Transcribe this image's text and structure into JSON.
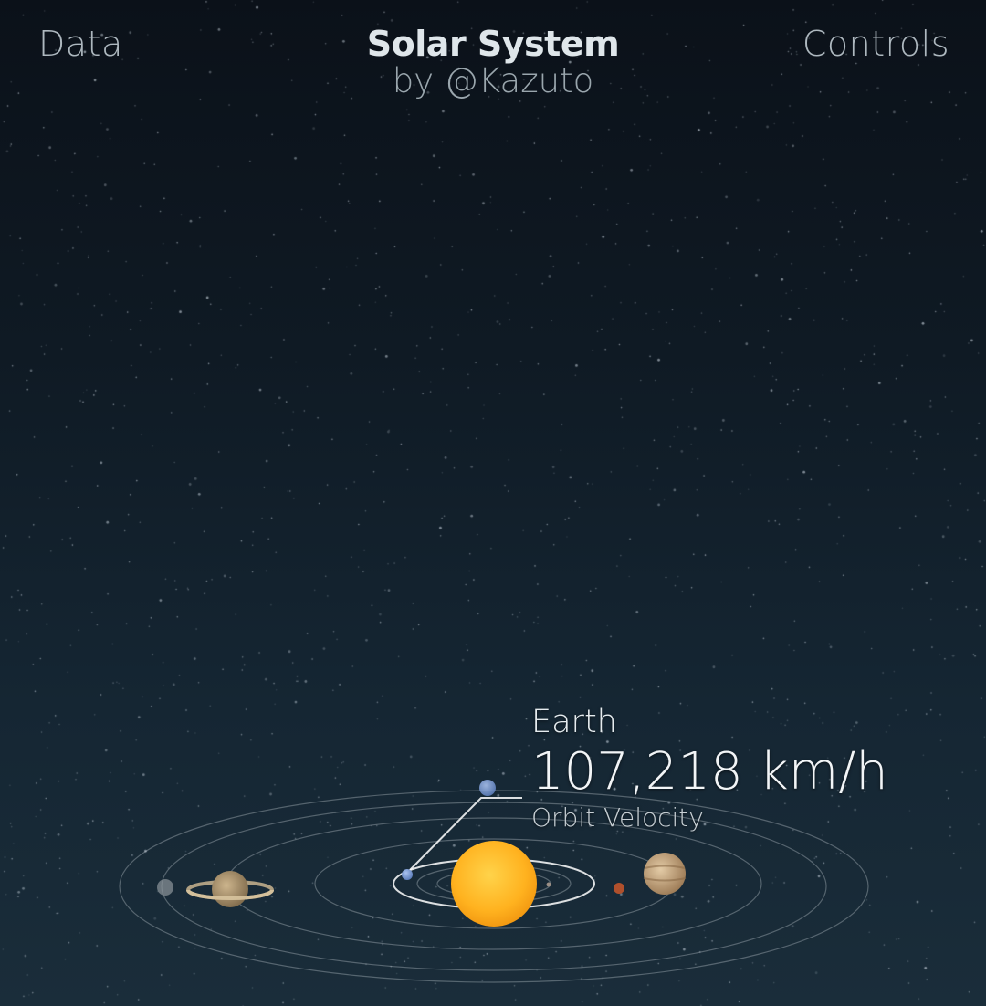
{
  "header": {
    "left_link": "Data",
    "title": "Solar System",
    "subtitle": "by @Kazuto",
    "right_link": "Controls"
  },
  "selected_planet": {
    "name": "Earth",
    "value": "107,218 km/h",
    "label": "Orbit Velocity"
  },
  "colors": {
    "sun": "#ffb21f",
    "earth": "#7d9fd6",
    "mars": "#b0502c",
    "jupiter": "#c9a47a",
    "saturn": "#b9a07a",
    "orbit": "#c9d2d8"
  },
  "bodies": [
    {
      "id": "sun",
      "name": "sun-icon"
    },
    {
      "id": "mercury",
      "name": "mercury-icon"
    },
    {
      "id": "venus",
      "name": "venus-icon"
    },
    {
      "id": "earth",
      "name": "earth-icon"
    },
    {
      "id": "moon",
      "name": "moon-icon"
    },
    {
      "id": "mars",
      "name": "mars-icon"
    },
    {
      "id": "jupiter",
      "name": "jupiter-icon"
    },
    {
      "id": "saturn",
      "name": "saturn-icon"
    },
    {
      "id": "uranus",
      "name": "uranus-icon"
    }
  ]
}
